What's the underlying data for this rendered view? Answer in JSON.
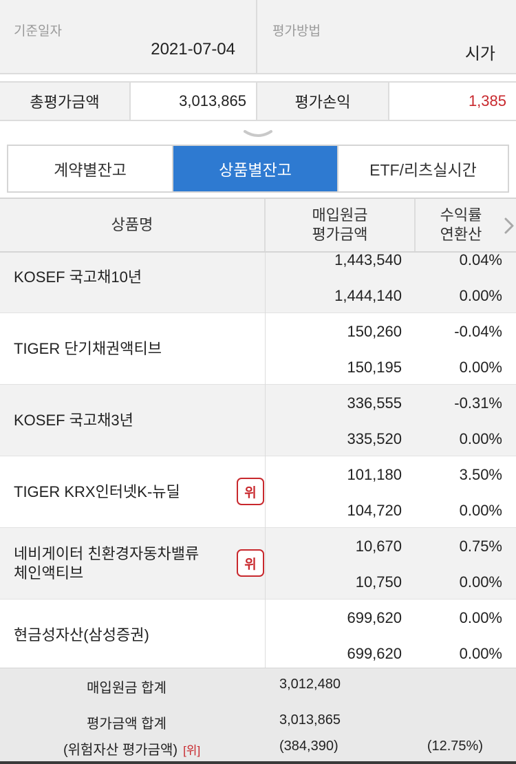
{
  "info": {
    "base_date_label": "기준일자",
    "base_date_value": "2021-07-04",
    "method_label": "평가방법",
    "method_value": "시가"
  },
  "summary": {
    "total_eval_label": "총평가금액",
    "total_eval_value": "3,013,865",
    "pnl_label": "평가손익",
    "pnl_value": "1,385"
  },
  "tabs": [
    {
      "label": "계약별잔고",
      "active": false
    },
    {
      "label": "상품별잔고",
      "active": true
    },
    {
      "label": "ETF/리츠실시간",
      "active": false
    }
  ],
  "table": {
    "headers": {
      "product": "상품명",
      "amount_line1": "매입원금",
      "amount_line2": "평가금액",
      "rate_line1": "수익률",
      "rate_line2": "연환산"
    },
    "rows": [
      {
        "name_line1": "KOSEF 국고채10년",
        "name_line2": "",
        "risk": "",
        "purchase": "1,443,540",
        "eval": "1,444,140",
        "return": "0.04%",
        "annual": "0.00%",
        "return_color": "red"
      },
      {
        "name_line1": "TIGER 단기채권액티브",
        "name_line2": "",
        "risk": "",
        "purchase": "150,260",
        "eval": "150,195",
        "return": "-0.04%",
        "annual": "0.00%",
        "return_color": "blue"
      },
      {
        "name_line1": "KOSEF 국고채3년",
        "name_line2": "",
        "risk": "",
        "purchase": "336,555",
        "eval": "335,520",
        "return": "-0.31%",
        "annual": "0.00%",
        "return_color": "blue"
      },
      {
        "name_line1": "TIGER KRX인터넷K-뉴딜",
        "name_line2": "",
        "risk": "위",
        "purchase": "101,180",
        "eval": "104,720",
        "return": "3.50%",
        "annual": "0.00%",
        "return_color": "red"
      },
      {
        "name_line1": "네비게이터 친환경자동차밸류",
        "name_line2": "체인액티브",
        "risk": "위",
        "purchase": "10,670",
        "eval": "10,750",
        "return": "0.75%",
        "annual": "0.00%",
        "return_color": "red"
      },
      {
        "name_line1": "현금성자산(삼성증권)",
        "name_line2": "",
        "risk": "",
        "purchase": "699,620",
        "eval": "699,620",
        "return": "0.00%",
        "annual": "0.00%",
        "return_color": "black"
      }
    ]
  },
  "footer": {
    "purchase_total_label": "매입원금 합계",
    "purchase_total_value": "3,012,480",
    "eval_total_label": "평가금액 합계",
    "eval_total_value": "3,013,865",
    "risk_eval_label": "(위험자산 평가금액)",
    "risk_mark": "[위]",
    "risk_eval_value": "(384,390)",
    "risk_eval_pct": "(12.75%)"
  },
  "colors": {
    "accent": "#2e7ad1",
    "positive": "#c8282d",
    "negative": "#2456a0"
  }
}
